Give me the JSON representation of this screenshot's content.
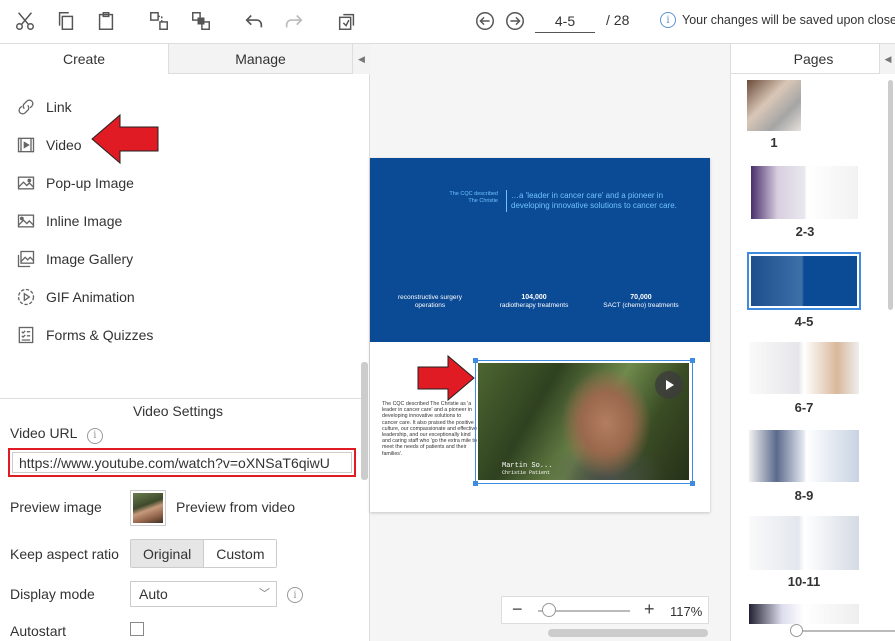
{
  "toolbar": {
    "icons": [
      "cut-icon",
      "copy-icon",
      "paste-icon",
      "group-icon",
      "ungroup-icon",
      "undo-icon",
      "redo-icon",
      "replace-icon"
    ],
    "page_range": "4-5",
    "page_total": "/ 28",
    "info_text": "Your changes will be saved upon close"
  },
  "left": {
    "tabs": {
      "create": "Create",
      "manage": "Manage"
    },
    "create_items": [
      "Link",
      "Video",
      "Pop-up Image",
      "Inline Image",
      "Image Gallery",
      "GIF Animation",
      "Forms & Quizzes"
    ],
    "settings": {
      "title": "Video Settings",
      "url_label": "Video URL",
      "url_value": "https://www.youtube.com/watch?v=oXNSaT6qiwU",
      "preview_label": "Preview image",
      "preview_text": "Preview from video",
      "aspect_label": "Keep aspect ratio",
      "aspect_options": [
        "Original",
        "Custom"
      ],
      "display_label": "Display mode",
      "display_value": "Auto",
      "autostart_label": "Autostart"
    }
  },
  "spread": {
    "quote_left": "The CQC described The Christie",
    "quote_right": "…a 'leader in cancer care' and a pioneer in developing innovative solutions to cancer care.",
    "stat1_label": "reconstructive surgery operations",
    "stat2_value": "104,000",
    "stat2_label": "radiotherapy treatments",
    "stat3_value": "70,000",
    "stat3_label": "SACT (chemo) treatments",
    "body_text": "The CQC described The Christie as 'a leader in cancer care' and a pioneer in developing innovative solutions to cancer care. It also praised the positive culture, our compassionate and effective leadership, and our exceptionally kind and caring staff who 'go the extra mile to meet the needs of patients and their families'.",
    "video_name_line1": "Martin So...",
    "video_name_line2": "Christie Patient"
  },
  "zoom": {
    "percent": "117%"
  },
  "pages": {
    "title": "Pages",
    "items": [
      "1",
      "2-3",
      "4-5",
      "6-7",
      "8-9",
      "10-11"
    ]
  }
}
